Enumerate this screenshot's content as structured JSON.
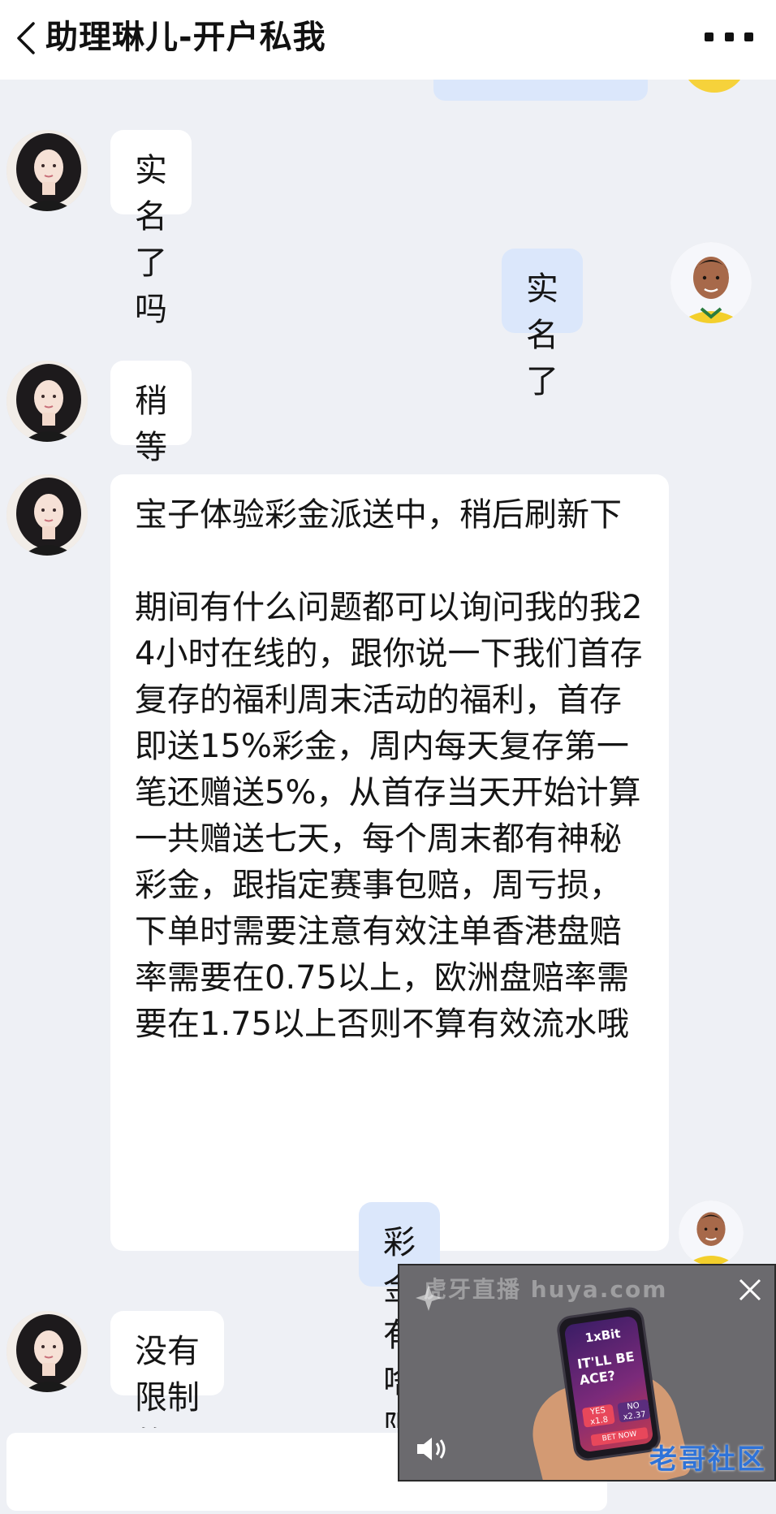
{
  "header": {
    "title": "助理琳儿-开户私我",
    "back_icon": "chevron-left-icon",
    "more_icon": "more-dots-icon"
  },
  "messages": [
    {
      "side": "left",
      "text": "实名了吗"
    },
    {
      "side": "right",
      "text": "实名了"
    },
    {
      "side": "left",
      "text": "稍等"
    },
    {
      "side": "left",
      "text": "宝子体验彩金派送中，稍后刷新下\n\n期间有什么问题都可以询问我的我24小时在线的，跟你说一下我们首存复存的福利周末活动的福利，首存即送15%彩金，周内每天复存第一笔还赠送5%，从首存当天开始计算一共赠送七天，每个周末都有神秘彩金，跟指定赛事包赔，周亏损，下单时需要注意有效注单香港盘赔率需要在0.75以上，欧洲盘赔率需要在1.75以上否则不算有效流水哦"
    },
    {
      "side": "right",
      "text": "彩金有啥限制不"
    },
    {
      "side": "left",
      "text": "没有限制的哦！"
    }
  ],
  "video_ad": {
    "watermark": "虎牙直播 huya.com",
    "brand": "1xBit",
    "headline": "IT'LL BE ACE?",
    "yes_label": "YES",
    "yes_odds": "x1.8",
    "no_label": "NO",
    "no_odds": "x2.37",
    "cta": "BET NOW",
    "logo": "老哥社区",
    "close_icon": "close-icon",
    "volume_icon": "volume-icon",
    "pin_icon": "pin-icon"
  },
  "input": {
    "placeholder": ""
  },
  "colors": {
    "background": "#eef0f5",
    "left_bubble": "#ffffff",
    "right_bubble": "#dbe7fb",
    "header_bg": "#ffffff"
  }
}
